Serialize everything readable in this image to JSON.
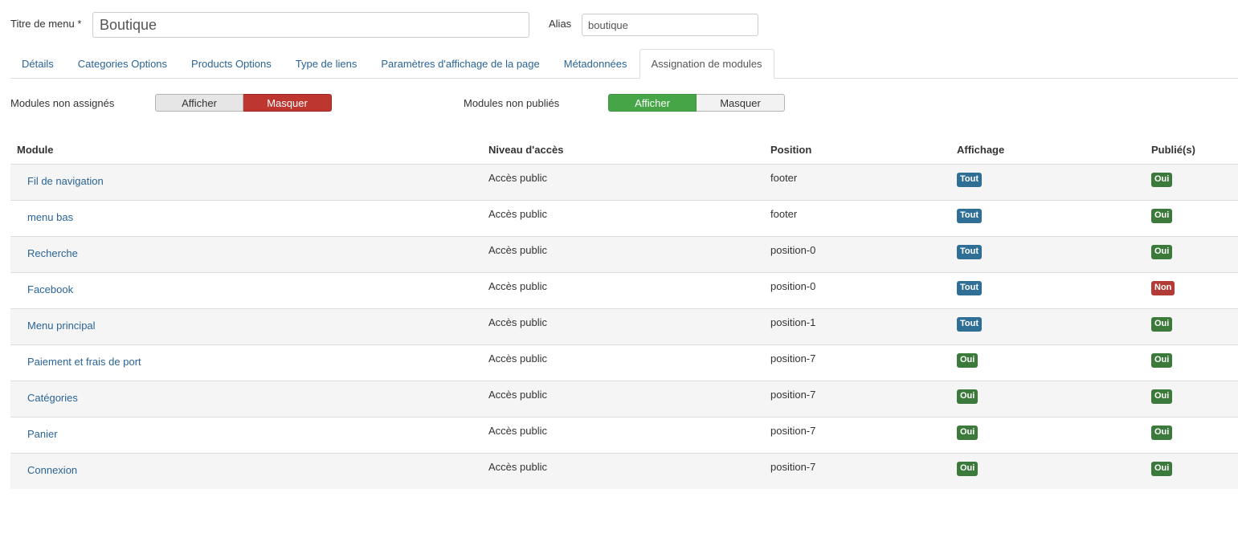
{
  "form": {
    "title_label": "Titre de menu *",
    "title_value": "Boutique",
    "alias_label": "Alias",
    "alias_value": "boutique"
  },
  "tabs": [
    {
      "label": "Détails",
      "active": false
    },
    {
      "label": "Categories Options",
      "active": false
    },
    {
      "label": "Products Options",
      "active": false
    },
    {
      "label": "Type de liens",
      "active": false
    },
    {
      "label": "Paramètres d'affichage de la page",
      "active": false
    },
    {
      "label": "Métadonnées",
      "active": false
    },
    {
      "label": "Assignation de modules",
      "active": true
    }
  ],
  "filters": {
    "unassigned": {
      "label": "Modules non assignés",
      "show_label": "Afficher",
      "hide_label": "Masquer",
      "selected": "Masquer"
    },
    "unpublished": {
      "label": "Modules non publiés",
      "show_label": "Afficher",
      "hide_label": "Masquer",
      "selected": "Afficher"
    }
  },
  "table": {
    "headers": [
      "Module",
      "Niveau d'accès",
      "Position",
      "Affichage",
      "Publié(s)"
    ],
    "rows": [
      {
        "module": "Fil de navigation",
        "access": "Accès public",
        "position": "footer",
        "display": "Tout",
        "published": "Oui"
      },
      {
        "module": "menu bas",
        "access": "Accès public",
        "position": "footer",
        "display": "Tout",
        "published": "Oui"
      },
      {
        "module": "Recherche",
        "access": "Accès public",
        "position": "position-0",
        "display": "Tout",
        "published": "Oui"
      },
      {
        "module": "Facebook",
        "access": "Accès public",
        "position": "position-0",
        "display": "Tout",
        "published": "Non"
      },
      {
        "module": "Menu principal",
        "access": "Accès public",
        "position": "position-1",
        "display": "Tout",
        "published": "Oui"
      },
      {
        "module": "Paiement et frais de port",
        "access": "Accès public",
        "position": "position-7",
        "display": "Oui",
        "published": "Oui"
      },
      {
        "module": "Catégories",
        "access": "Accès public",
        "position": "position-7",
        "display": "Oui",
        "published": "Oui"
      },
      {
        "module": "Panier",
        "access": "Accès public",
        "position": "position-7",
        "display": "Oui",
        "published": "Oui"
      },
      {
        "module": "Connexion",
        "access": "Accès public",
        "position": "position-7",
        "display": "Oui",
        "published": "Oui"
      }
    ]
  },
  "colors": {
    "badge_tout": "#2f6f95",
    "badge_oui": "#3b7a3b",
    "badge_non": "#b23c35",
    "link": "#2a6496",
    "danger": "#bd362f",
    "success": "#46a546"
  }
}
